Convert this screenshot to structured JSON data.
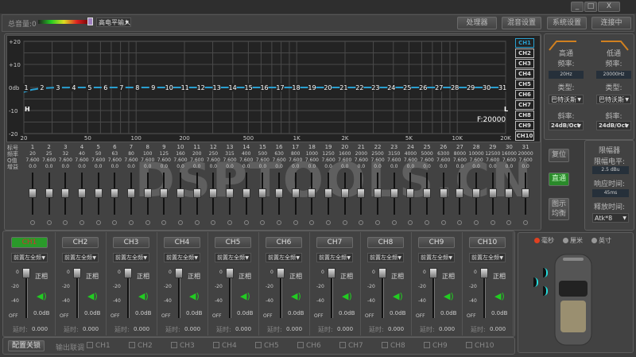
{
  "window": {
    "minimize": "_",
    "maximize": "□",
    "close": "X"
  },
  "toolbar": {
    "master_volume": "总音量:0",
    "input_select": "高电平输入",
    "buttons": [
      "处理器",
      "混音设置",
      "系统设置",
      "连接中"
    ]
  },
  "eq_graph": {
    "y_ticks": [
      "+20",
      "+10",
      "0db",
      "-10",
      "-20"
    ],
    "x_ticks": [
      {
        "f": 20,
        "label": "20"
      },
      {
        "f": 50,
        "label": "50"
      },
      {
        "f": 100,
        "label": "100"
      },
      {
        "f": 200,
        "label": "200"
      },
      {
        "f": 500,
        "label": "500"
      },
      {
        "f": 1000,
        "label": "1K"
      },
      {
        "f": 2000,
        "label": "2K"
      },
      {
        "f": 5000,
        "label": "5K"
      },
      {
        "f": 10000,
        "label": "10K"
      },
      {
        "f": 20000,
        "label": "20K"
      }
    ],
    "hp_marker": "H",
    "lp_marker": "L",
    "freq_readout": "F:20000",
    "curve_color": "#2a9fd0",
    "channels": [
      "CH1",
      "CH2",
      "CH3",
      "CH4",
      "CH5",
      "CH6",
      "CH7",
      "CH8",
      "CH9",
      "CH10"
    ],
    "selected_channel": "CH1"
  },
  "bands": {
    "row_labels": [
      "标号",
      "频率",
      "Q值",
      "增益"
    ],
    "freqs": [
      "20",
      "25",
      "32",
      "40",
      "50",
      "63",
      "80",
      "100",
      "125",
      "160",
      "200",
      "250",
      "315",
      "400",
      "500",
      "630",
      "800",
      "1000",
      "1250",
      "1600",
      "2000",
      "2500",
      "3150",
      "4000",
      "5000",
      "6300",
      "8000",
      "10000",
      "12500",
      "16000",
      "20000"
    ],
    "q": "7.600",
    "gain": "0.0",
    "gain_db": 0
  },
  "watermark": "DSPTOOLS.CN",
  "eq_buttons": {
    "reset": "复位",
    "bypass": "直通",
    "graphic_eq": "图示\n均衡"
  },
  "crossover": {
    "highpass": {
      "title": "高通",
      "freq_label": "频率:",
      "freq": "20Hz",
      "type_label": "类型:",
      "type": "巴特沃斯",
      "slope_label": "斜率:",
      "slope": "24dB/Oct"
    },
    "lowpass": {
      "title": "低通",
      "freq_label": "频率:",
      "freq": "20000Hz",
      "type_label": "类型:",
      "type": "巴特沃斯",
      "slope_label": "斜率:",
      "slope": "24dB/Oct"
    }
  },
  "limiter": {
    "title": "限幅器",
    "level_label": "限幅电平:",
    "level": "2.5 dBu",
    "attack_label": "响应时间:",
    "attack": "45ms",
    "release_label": "释放时间:",
    "release": "Atk*8"
  },
  "outputs": {
    "source": "前置左全频",
    "scale": [
      "0",
      "-20",
      "-40",
      "OFF"
    ],
    "phase": "正相",
    "level": "0.0dB",
    "delay_label": "延时:",
    "delay": "0.000",
    "active": "CH1"
  },
  "bottom": {
    "lock_button": "配置关锁",
    "link_label": "输出联调"
  },
  "units": [
    "毫秒",
    "厘米",
    "英寸"
  ],
  "selected_unit": "毫秒"
}
